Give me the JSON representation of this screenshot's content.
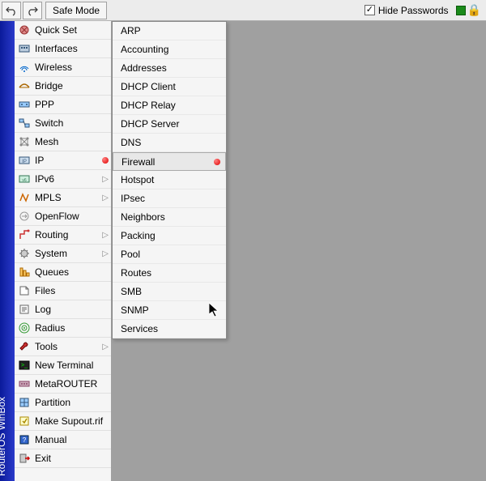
{
  "toolbar": {
    "safe_mode": "Safe Mode",
    "hide_passwords": "Hide Passwords"
  },
  "sidebar_title": "RouterOS WinBox",
  "menu": [
    {
      "label": "Quick Set",
      "icon": "quickset",
      "arrow": false
    },
    {
      "label": "Interfaces",
      "icon": "interfaces",
      "arrow": false
    },
    {
      "label": "Wireless",
      "icon": "wireless",
      "arrow": false
    },
    {
      "label": "Bridge",
      "icon": "bridge",
      "arrow": false
    },
    {
      "label": "PPP",
      "icon": "ppp",
      "arrow": false
    },
    {
      "label": "Switch",
      "icon": "switch",
      "arrow": false
    },
    {
      "label": "Mesh",
      "icon": "mesh",
      "arrow": false
    },
    {
      "label": "IP",
      "icon": "ip",
      "arrow": false,
      "reddot": true
    },
    {
      "label": "IPv6",
      "icon": "ipv6",
      "arrow": true
    },
    {
      "label": "MPLS",
      "icon": "mpls",
      "arrow": true
    },
    {
      "label": "OpenFlow",
      "icon": "openflow",
      "arrow": false
    },
    {
      "label": "Routing",
      "icon": "routing",
      "arrow": true
    },
    {
      "label": "System",
      "icon": "system",
      "arrow": true
    },
    {
      "label": "Queues",
      "icon": "queues",
      "arrow": false
    },
    {
      "label": "Files",
      "icon": "files",
      "arrow": false
    },
    {
      "label": "Log",
      "icon": "log",
      "arrow": false
    },
    {
      "label": "Radius",
      "icon": "radius",
      "arrow": false
    },
    {
      "label": "Tools",
      "icon": "tools",
      "arrow": true
    },
    {
      "label": "New Terminal",
      "icon": "terminal",
      "arrow": false
    },
    {
      "label": "MetaROUTER",
      "icon": "metarouter",
      "arrow": false
    },
    {
      "label": "Partition",
      "icon": "partition",
      "arrow": false
    },
    {
      "label": "Make Supout.rif",
      "icon": "supout",
      "arrow": false
    },
    {
      "label": "Manual",
      "icon": "manual",
      "arrow": false
    },
    {
      "label": "Exit",
      "icon": "exit",
      "arrow": false
    }
  ],
  "submenu": [
    {
      "label": "ARP"
    },
    {
      "label": "Accounting"
    },
    {
      "label": "Addresses"
    },
    {
      "label": "DHCP Client"
    },
    {
      "label": "DHCP Relay"
    },
    {
      "label": "DHCP Server"
    },
    {
      "label": "DNS"
    },
    {
      "label": "Firewall",
      "hovered": true,
      "reddot": true
    },
    {
      "label": "Hotspot"
    },
    {
      "label": "IPsec"
    },
    {
      "label": "Neighbors"
    },
    {
      "label": "Packing"
    },
    {
      "label": "Pool"
    },
    {
      "label": "Routes"
    },
    {
      "label": "SMB"
    },
    {
      "label": "SNMP"
    },
    {
      "label": "Services"
    }
  ]
}
